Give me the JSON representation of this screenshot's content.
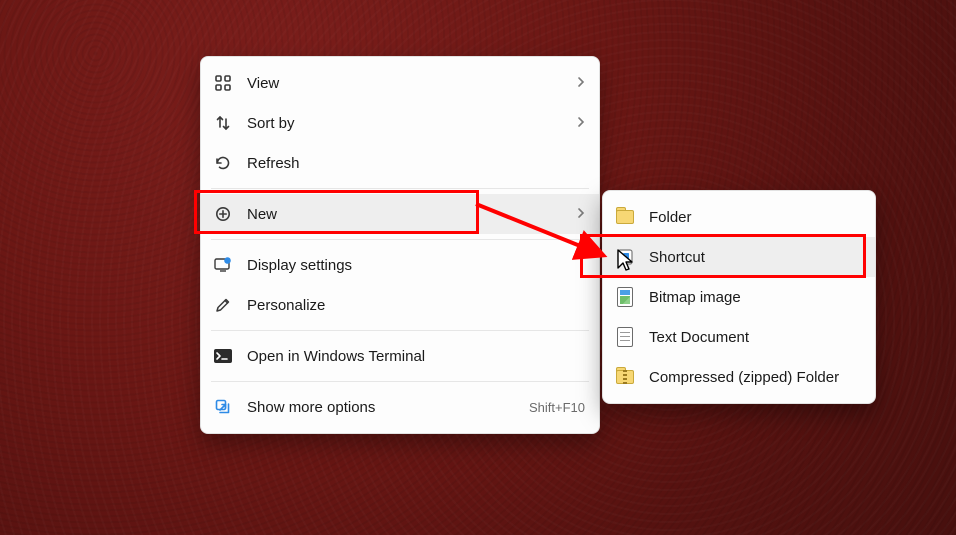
{
  "main_menu": {
    "items": [
      {
        "label": "View",
        "has_submenu": true
      },
      {
        "label": "Sort by",
        "has_submenu": true
      },
      {
        "label": "Refresh"
      },
      {
        "label": "New",
        "has_submenu": true,
        "highlighted": true
      },
      {
        "label": "Display settings"
      },
      {
        "label": "Personalize"
      },
      {
        "label": "Open in Windows Terminal"
      },
      {
        "label": "Show more options",
        "accelerator": "Shift+F10"
      }
    ]
  },
  "sub_menu": {
    "items": [
      {
        "label": "Folder"
      },
      {
        "label": "Shortcut",
        "highlighted": true
      },
      {
        "label": "Bitmap image"
      },
      {
        "label": "Text Document"
      },
      {
        "label": "Compressed (zipped) Folder"
      }
    ]
  },
  "annotation": {
    "kind": "red-arrow",
    "from": "main_menu.items.3",
    "to": "sub_menu.items.1"
  }
}
